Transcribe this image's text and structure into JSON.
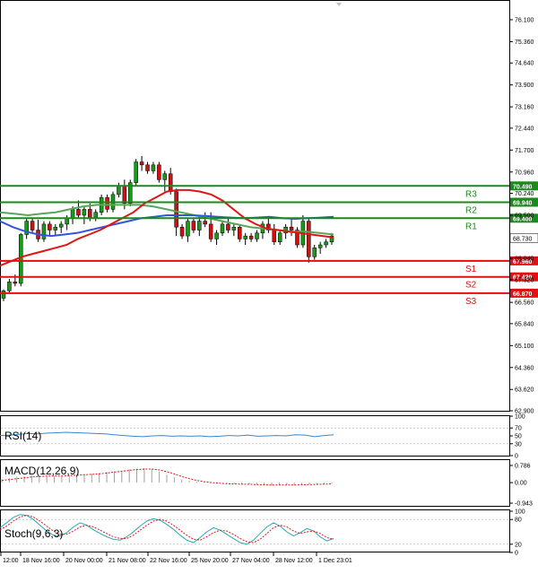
{
  "chart_data": [
    {
      "type": "candlestick",
      "panel": "price",
      "ylim": [
        62.9,
        76.6
      ],
      "y_ticks": [
        "76.100",
        "75.360",
        "74.640",
        "73.900",
        "73.160",
        "72.440",
        "71.700",
        "70.960",
        "70.240",
        "69.500",
        "68.780",
        "68.040",
        "67.320",
        "66.560",
        "65.840",
        "65.100",
        "64.360",
        "63.620",
        "62.900"
      ],
      "x_ticks": [
        "12:00",
        "18 Nov 16:00",
        "20 Nov 00:00",
        "21 Nov 08:00",
        "22 Nov 16:00",
        "25 Nov 20:00",
        "27 Nov 04:00",
        "28 Nov 12:00",
        "1 Dec 23:01"
      ],
      "current_price": "68.730",
      "levels": [
        {
          "name": "R3",
          "value": 70.49,
          "label": "70.490",
          "color": "#1a8a1a"
        },
        {
          "name": "R2",
          "value": 69.94,
          "label": "69.940",
          "color": "#1a8a1a"
        },
        {
          "name": "R1",
          "value": 69.4,
          "label": "69.400",
          "color": "#1a8a1a"
        },
        {
          "name": "S1",
          "value": 67.96,
          "label": "67.960",
          "color": "#e01010"
        },
        {
          "name": "S2",
          "value": 67.42,
          "label": "67.420",
          "color": "#e01010"
        },
        {
          "name": "S3",
          "value": 66.87,
          "label": "66.870",
          "color": "#e01010"
        }
      ],
      "candles_ohlc": [
        [
          66.7,
          67.0,
          66.6,
          66.95
        ],
        [
          66.95,
          67.35,
          66.85,
          67.25
        ],
        [
          67.25,
          67.5,
          67.1,
          67.2
        ],
        [
          67.2,
          68.9,
          67.1,
          68.85
        ],
        [
          68.85,
          69.4,
          68.7,
          69.3
        ],
        [
          69.3,
          69.4,
          68.9,
          69.0
        ],
        [
          69.0,
          69.35,
          68.6,
          68.7
        ],
        [
          68.7,
          69.3,
          68.6,
          69.2
        ],
        [
          69.2,
          69.3,
          68.8,
          69.0
        ],
        [
          69.0,
          69.2,
          68.8,
          69.1
        ],
        [
          69.1,
          69.3,
          68.9,
          69.2
        ],
        [
          69.2,
          69.5,
          69.0,
          69.4
        ],
        [
          69.4,
          69.8,
          69.2,
          69.7
        ],
        [
          69.7,
          70.0,
          69.4,
          69.5
        ],
        [
          69.5,
          69.8,
          69.2,
          69.7
        ],
        [
          69.7,
          69.9,
          69.3,
          69.4
        ],
        [
          69.4,
          69.7,
          69.3,
          69.6
        ],
        [
          69.6,
          70.2,
          69.5,
          70.1
        ],
        [
          70.1,
          70.2,
          69.6,
          69.7
        ],
        [
          69.7,
          70.3,
          69.6,
          70.2
        ],
        [
          70.2,
          70.6,
          70.1,
          70.5
        ],
        [
          70.5,
          70.7,
          69.7,
          69.9
        ],
        [
          69.9,
          70.7,
          69.8,
          70.6
        ],
        [
          70.6,
          71.4,
          70.5,
          71.3
        ],
        [
          71.3,
          71.5,
          71.0,
          71.2
        ],
        [
          71.2,
          71.3,
          70.9,
          71.0
        ],
        [
          71.0,
          71.3,
          70.9,
          71.2
        ],
        [
          71.2,
          71.3,
          70.6,
          70.7
        ],
        [
          70.7,
          71.0,
          70.3,
          70.9
        ],
        [
          70.9,
          71.1,
          70.2,
          70.3
        ],
        [
          70.3,
          70.4,
          68.8,
          69.1
        ],
        [
          69.1,
          69.2,
          68.7,
          68.8
        ],
        [
          68.8,
          69.4,
          68.6,
          69.3
        ],
        [
          69.3,
          69.4,
          68.9,
          69.0
        ],
        [
          69.0,
          69.5,
          68.8,
          69.3
        ],
        [
          69.3,
          69.6,
          69.1,
          69.2
        ],
        [
          69.2,
          69.6,
          68.6,
          68.7
        ],
        [
          68.7,
          69.0,
          68.5,
          68.9
        ],
        [
          68.9,
          69.3,
          68.8,
          69.2
        ],
        [
          69.2,
          69.4,
          68.9,
          69.0
        ],
        [
          69.0,
          69.2,
          68.8,
          69.1
        ],
        [
          69.1,
          69.2,
          68.6,
          68.7
        ],
        [
          68.7,
          68.9,
          68.5,
          68.8
        ],
        [
          68.8,
          68.9,
          68.6,
          68.7
        ],
        [
          68.7,
          69.0,
          68.6,
          68.9
        ],
        [
          68.9,
          69.3,
          68.7,
          69.2
        ],
        [
          69.2,
          69.4,
          68.9,
          69.0
        ],
        [
          69.0,
          69.2,
          68.5,
          68.6
        ],
        [
          68.6,
          69.0,
          68.5,
          68.9
        ],
        [
          68.9,
          69.2,
          68.7,
          69.1
        ],
        [
          69.1,
          69.4,
          68.8,
          69.0
        ],
        [
          69.0,
          69.1,
          68.4,
          68.5
        ],
        [
          68.5,
          69.5,
          68.4,
          69.3
        ],
        [
          69.3,
          69.4,
          67.9,
          68.1
        ],
        [
          68.1,
          68.5,
          68.0,
          68.4
        ],
        [
          68.4,
          68.6,
          68.2,
          68.5
        ],
        [
          68.5,
          68.7,
          68.4,
          68.6
        ],
        [
          68.6,
          68.9,
          68.5,
          68.8
        ]
      ],
      "ma_red": [
        67.8,
        67.95,
        68.1,
        68.2,
        68.3,
        68.4,
        68.5,
        68.7,
        68.85,
        69.0,
        69.2,
        69.4,
        69.6,
        69.9,
        70.1,
        70.3,
        70.35,
        70.35,
        70.3,
        70.2,
        70.0,
        69.7,
        69.4,
        69.2,
        69.05,
        69.0,
        68.95,
        68.9,
        68.85,
        68.8,
        68.75
      ],
      "ma_blue": [
        69.3,
        69.1,
        68.95,
        68.85,
        68.8,
        68.85,
        68.9,
        69.0,
        69.1,
        69.2,
        69.3,
        69.4,
        69.45,
        69.5,
        69.5,
        69.5,
        69.48,
        69.45,
        69.42,
        69.4,
        69.42,
        69.45,
        69.4,
        69.38,
        69.4,
        69.42,
        69.45
      ],
      "ma_green": [
        69.6,
        69.55,
        69.5,
        69.55,
        69.6,
        69.7,
        69.8,
        69.85,
        69.85,
        69.85,
        69.85,
        69.8,
        69.7,
        69.6,
        69.5,
        69.4,
        69.3,
        69.2,
        69.1,
        69.05,
        69.0,
        68.95,
        68.95,
        68.9,
        68.85
      ]
    },
    {
      "type": "line",
      "panel": "RSI",
      "title": "RSI(14)",
      "ylim": [
        0,
        100
      ],
      "y_ticks": [
        "100",
        "70",
        "50",
        "30",
        "0"
      ],
      "values": [
        51,
        52,
        54,
        56,
        55,
        57,
        58,
        59,
        58,
        57,
        56,
        55,
        53,
        51,
        49,
        48,
        50,
        51,
        49,
        50,
        49,
        50,
        48,
        49,
        51,
        50,
        52,
        49,
        50,
        51,
        50,
        53,
        52,
        48,
        51,
        53
      ]
    },
    {
      "type": "bar",
      "panel": "MACD",
      "title": "MACD(12,26,9)",
      "ylim": [
        -0.943,
        0.786
      ],
      "y_ticks": [
        "0.786",
        "0.00",
        "-0.943"
      ],
      "histogram": [
        0.15,
        0.2,
        0.26,
        0.3,
        0.32,
        0.3,
        0.28,
        0.28,
        0.3,
        0.32,
        0.34,
        0.36,
        0.4,
        0.44,
        0.48,
        0.52,
        0.55,
        0.6,
        0.64,
        0.66,
        0.62,
        0.5,
        0.36,
        0.24,
        0.14,
        0.08,
        0.04,
        0.02,
        0.0,
        -0.02,
        -0.04,
        -0.05,
        -0.06,
        -0.08,
        -0.1,
        -0.12,
        -0.14,
        -0.12,
        -0.1,
        -0.12,
        -0.1,
        -0.08,
        -0.06,
        -0.06,
        -0.05
      ],
      "signal": [
        0.1,
        0.14,
        0.18,
        0.22,
        0.26,
        0.28,
        0.3,
        0.3,
        0.3,
        0.32,
        0.34,
        0.36,
        0.38,
        0.4,
        0.44,
        0.48,
        0.52,
        0.56,
        0.6,
        0.62,
        0.62,
        0.58,
        0.5,
        0.4,
        0.28,
        0.18,
        0.1,
        0.04,
        0.0,
        -0.03,
        -0.05,
        -0.06,
        -0.07,
        -0.08,
        -0.09,
        -0.1,
        -0.11,
        -0.11,
        -0.11,
        -0.11,
        -0.1,
        -0.09,
        -0.08,
        -0.07,
        -0.06
      ]
    },
    {
      "type": "line",
      "panel": "Stoch",
      "title": "Stoch(9,6,3)",
      "ylim": [
        0,
        100
      ],
      "y_ticks": [
        "100",
        "80",
        "20",
        "0"
      ],
      "k": [
        60,
        72,
        85,
        92,
        90,
        80,
        66,
        52,
        42,
        40,
        48,
        62,
        72,
        66,
        55,
        46,
        38,
        32,
        30,
        38,
        50,
        64,
        76,
        82,
        78,
        68,
        56,
        42,
        30,
        24,
        36,
        50,
        60,
        54,
        44,
        34,
        24,
        20,
        30,
        46,
        62,
        72,
        64,
        50,
        40,
        48,
        58,
        52,
        38,
        28,
        34
      ],
      "d": [
        55,
        64,
        76,
        86,
        90,
        86,
        76,
        64,
        52,
        44,
        44,
        52,
        62,
        66,
        62,
        54,
        46,
        38,
        34,
        34,
        42,
        54,
        66,
        76,
        80,
        76,
        66,
        54,
        42,
        32,
        30,
        38,
        48,
        54,
        52,
        44,
        34,
        26,
        24,
        32,
        46,
        60,
        66,
        62,
        52,
        46,
        50,
        52,
        46,
        36,
        32
      ]
    }
  ]
}
